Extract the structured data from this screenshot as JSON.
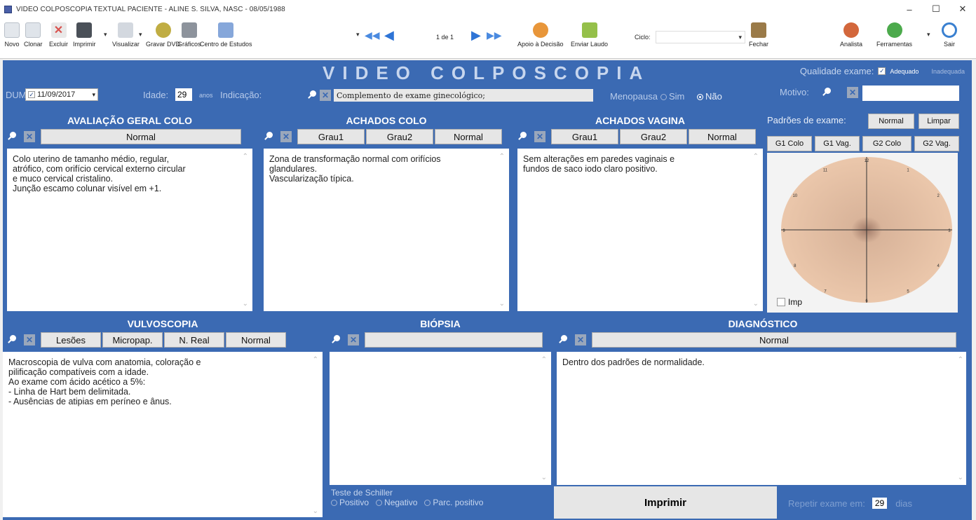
{
  "titlebar": {
    "title": "VIDEO COLPOSCOPIA TEXTUAL    PACIENTE - ALINE S. SILVA,   NASC - 08/05/1988",
    "minimize": "–",
    "maximize": "☐",
    "close": "✕"
  },
  "toolbar": {
    "novo": "Novo",
    "clonar": "Clonar",
    "excluir": "Excluir",
    "imprimir": "Imprimir",
    "visualizar": "Visualizar",
    "gravar_dvd": "Gravar DVD",
    "graficos": "Gráficos",
    "centro_estudos": "Centro de Estudos",
    "page_indicator": "1 de 1",
    "apoio": "Apoio à Decisão",
    "enviar_laudo": "Enviar Laudo",
    "ciclo_label": "Ciclo:",
    "ciclo_value": "",
    "fechar": "Fechar",
    "analista": "Analista",
    "ferramentas": "Ferramentas",
    "sair": "Sair",
    "icon_colors": {
      "novo": "#d8dde4",
      "clonar": "#cfd6df",
      "excluir": "#d9534f",
      "imprimir": "#444a52",
      "visualizar": "#c9ced6",
      "gravar_dvd": "#b5a23a",
      "graficos": "#8a8f98",
      "centro": "#7fa2d8",
      "nav": "#4a8ae0",
      "apoio": "#e6892b",
      "enviar": "#8dbb3c",
      "fechar": "#8b6b3e",
      "analista": "#d0633a",
      "ferramentas": "#4aa84a",
      "sair": "#3a80d0"
    }
  },
  "header": {
    "title": "VIDEO COLPOSCOPIA",
    "qualidade_label": "Qualidade exame:",
    "adequado": "Adequado",
    "inadequada": "Inadequada",
    "adequado_checked": true
  },
  "patient_row": {
    "dum_label": "DUM:",
    "dum_value": "11/09/2017",
    "idade_label": "Idade:",
    "idade_value": "29",
    "anos": "anos",
    "indicacao_label": "Indicação:",
    "indicacao_value": "Complemento de exame ginecológico;",
    "menopausa_label": "Menopausa",
    "sim": "Sim",
    "nao": "Não",
    "menopausa_selected": "Não",
    "motivo_label": "Motivo:",
    "motivo_value": ""
  },
  "avaliacao": {
    "title": "AVALIAÇÃO GERAL COLO",
    "normal_btn": "Normal",
    "text": "Colo uterino de tamanho médio, regular,\natrófico, com orifício cervical externo circular\ne muco cervical cristalino.\nJunção escamo colunar visível em +1."
  },
  "achados_colo": {
    "title": "ACHADOS COLO",
    "grau1": "Grau1",
    "grau2": "Grau2",
    "normal": "Normal",
    "text": "Zona de transformação normal com orifícios\nglandulares.\nVascularização típica."
  },
  "achados_vagina": {
    "title": "ACHADOS VAGINA",
    "grau1": "Grau1",
    "grau2": "Grau2",
    "normal": "Normal",
    "text": "Sem alterações em paredes vaginais e\nfundos de saco iodo claro positivo."
  },
  "padroes": {
    "label": "Padrões de exame:",
    "normal": "Normal",
    "limpar": "Limpar",
    "g1colo": "G1 Colo",
    "g1vag": "G1 Vag.",
    "g2colo": "G2 Colo",
    "g2vag": "G2 Vag.",
    "imp": "Imp",
    "clock": [
      "12",
      "1",
      "2",
      "3",
      "4",
      "5",
      "6",
      "7",
      "8",
      "9",
      "10",
      "11"
    ]
  },
  "vulvoscopia": {
    "title": "VULVOSCOPIA",
    "lesoes": "Lesões",
    "micropap": "Micropap.",
    "nreal": "N. Real",
    "normal": "Normal",
    "text": "Macroscopia de vulva com anatomia, coloração e\npilificação compatíveis com a idade.\nAo exame com ácido acético a 5%:\n- Linha de Hart bem delimitada.\n- Ausências de atipias em períneo e ânus."
  },
  "biopsia": {
    "title": "BIÓPSIA",
    "field": "",
    "text": "",
    "schiller_label": "Teste de Schiller",
    "positivo": "Positivo",
    "negativo": "Negativo",
    "parc": "Parc. positivo"
  },
  "diagnostico": {
    "title": "DIAGNÓSTICO",
    "normal": "Normal",
    "text": "Dentro dos padrões de normalidade.",
    "imprimir": "Imprimir",
    "repetir_label": "Repetir exame em:",
    "repetir_value": "29",
    "dias": "dias"
  }
}
